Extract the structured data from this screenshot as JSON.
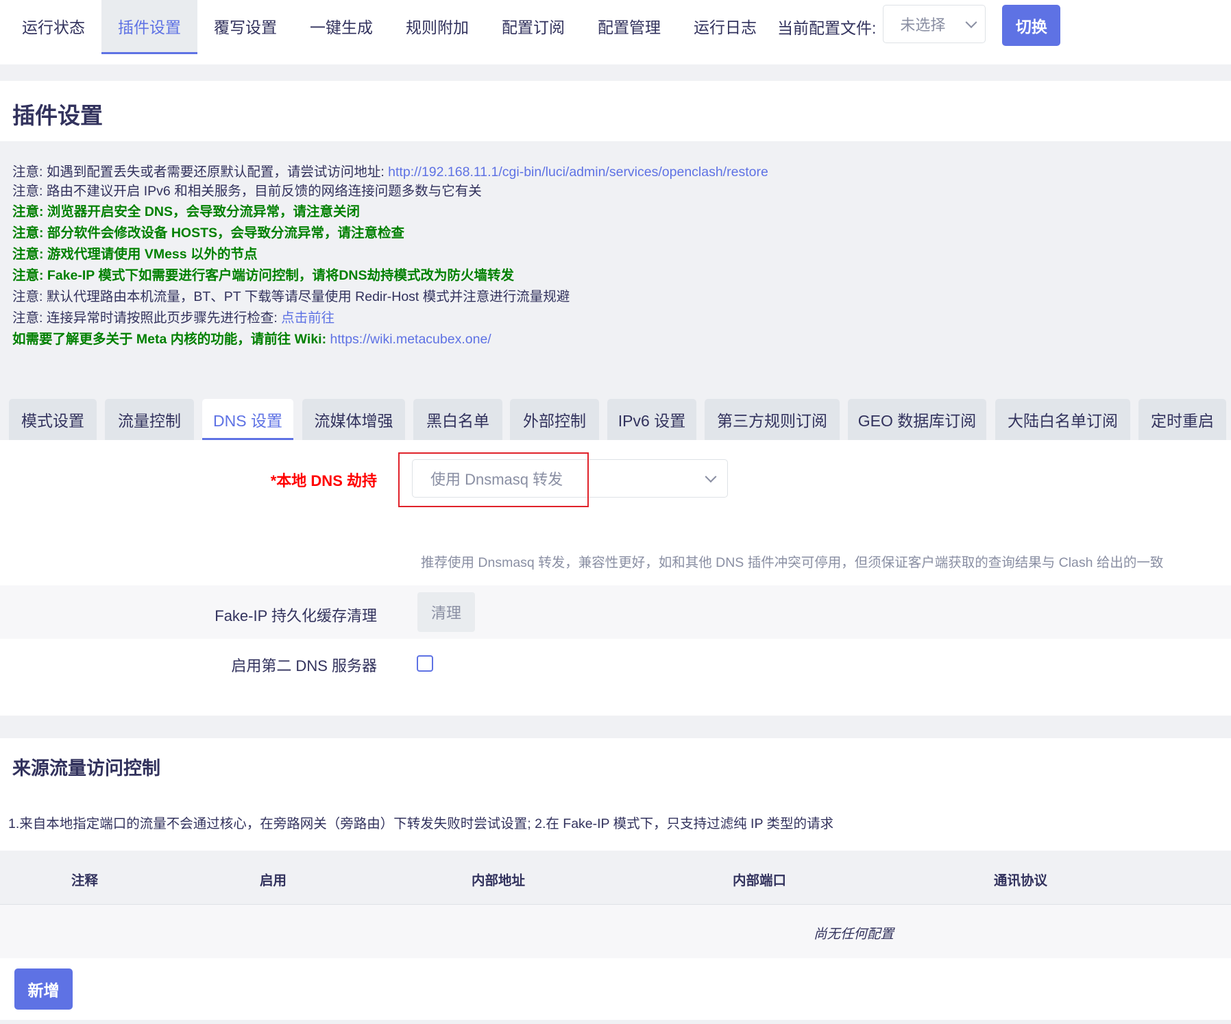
{
  "top_nav": {
    "tabs": [
      {
        "label": "运行状态"
      },
      {
        "label": "插件设置"
      },
      {
        "label": "覆写设置"
      },
      {
        "label": "一键生成"
      },
      {
        "label": "规则附加"
      },
      {
        "label": "配置订阅"
      },
      {
        "label": "配置管理"
      },
      {
        "label": "运行日志"
      }
    ],
    "active_tab": "插件设置",
    "config_file_label": "当前配置文件:",
    "config_file_value": "未选择",
    "switch_label": "切换"
  },
  "page": {
    "title": "插件设置"
  },
  "notes": {
    "n1_text": "注意: 如遇到配置丢失或者需要还原默认配置，请尝试访问地址: ",
    "n1_link": "http://192.168.11.1/cgi-bin/luci/admin/services/openclash/restore",
    "n2": "注意: 路由不建议开启 IPv6 和相关服务，目前反馈的网络连接问题多数与它有关",
    "n3": "注意: 浏览器开启安全 DNS，会导致分流异常，请注意关闭",
    "n4": "注意: 部分软件会修改设备 HOSTS，会导致分流异常，请注意检查",
    "n5": "注意: 游戏代理请使用 VMess 以外的节点",
    "n6": "注意: Fake-IP 模式下如需要进行客户端访问控制，请将DNS劫持模式改为防火墙转发",
    "n7": "注意: 默认代理路由本机流量，BT、PT 下载等请尽量使用 Redir-Host 模式并注意进行流量规避",
    "n8_text": "注意: 连接异常时请按照此页步骤先进行检查: ",
    "n8_link": "点击前往",
    "n9_text": "如需要了解更多关于 Meta 内核的功能，请前往 Wiki: ",
    "n9_link": "https://wiki.metacubex.one/"
  },
  "sub_tabs": [
    {
      "label": "模式设置"
    },
    {
      "label": "流量控制"
    },
    {
      "label": "DNS 设置"
    },
    {
      "label": "流媒体增强"
    },
    {
      "label": "黑白名单"
    },
    {
      "label": "外部控制"
    },
    {
      "label": "IPv6 设置"
    },
    {
      "label": "第三方规则订阅"
    },
    {
      "label": "GEO 数据库订阅"
    },
    {
      "label": "大陆白名单订阅"
    },
    {
      "label": "定时重启"
    }
  ],
  "active_sub_tab": "DNS 设置",
  "dns_settings": {
    "hijack_label": "*本地 DNS 劫持",
    "hijack_value": "使用 Dnsmasq 转发",
    "hijack_hint": "推荐使用 Dnsmasq 转发，兼容性更好，如和其他 DNS 插件冲突可停用，但须保证客户端获取的查询结果与 Clash 给出的一致",
    "fakeip_label": "Fake-IP 持久化缓存清理",
    "fakeip_button": "清理",
    "second_dns_label": "启用第二 DNS 服务器",
    "second_dns_checked": false
  },
  "source_control": {
    "title": "来源流量访问控制",
    "description": "1.来自本地指定端口的流量不会通过核心，在旁路网关（旁路由）下转发失败时尝试设置; 2.在 Fake-IP 模式下，只支持过滤纯 IP 类型的请求",
    "columns": [
      "注释",
      "启用",
      "内部地址",
      "内部端口",
      "通讯协议"
    ],
    "empty_text": "尚无任何配置",
    "add_button": "新增"
  },
  "colors": {
    "accent": "#5e72e4",
    "warning_green": "#008000",
    "required_red": "#ff0000",
    "highlight_box": "#e0222a"
  }
}
